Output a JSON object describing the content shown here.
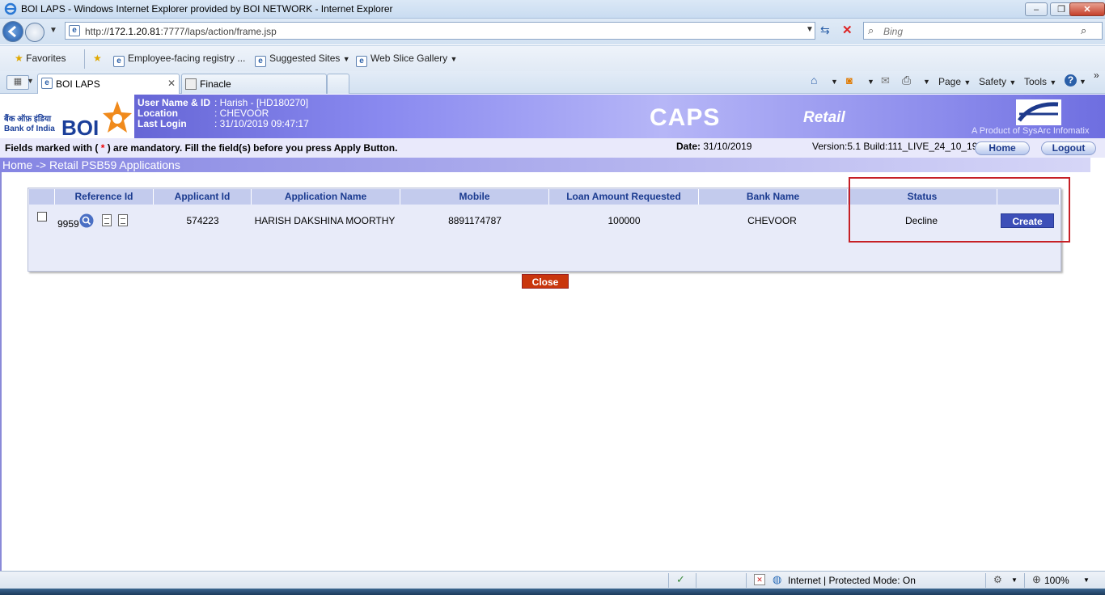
{
  "window": {
    "title": "BOI LAPS - Windows Internet Explorer provided by BOI NETWORK - Internet Explorer",
    "minimize": "–",
    "maximize": "❐",
    "close": "✕"
  },
  "address_bar": {
    "url_prefix": "http://",
    "url_host": "172.1.20.81",
    "url_path": ":7777/laps/action/frame.jsp",
    "search_placeholder": "Bing"
  },
  "favorites_bar": {
    "favorites_label": "Favorites",
    "items": [
      "Employee-facing registry ...",
      "Suggested Sites",
      "Web Slice Gallery"
    ]
  },
  "tabs": [
    {
      "label": "BOI LAPS",
      "active": true
    },
    {
      "label": "Finacle",
      "active": false
    }
  ],
  "command_bar": {
    "page": "Page",
    "safety": "Safety",
    "tools": "Tools"
  },
  "app_header": {
    "logo_hindi": "बैंक ऑफ़ इंडिया",
    "logo_en": "Bank of India",
    "logo_boi": "BOI",
    "user_label": "User Name & ID",
    "user_value": ":  Harish - [HD180270]",
    "location_label": "Location",
    "location_value": ":  CHEVOOR",
    "last_login_label": "Last Login",
    "last_login_value": ": 31/10/2019 09:47:17",
    "product": "CAPS",
    "module": "Retail",
    "vendor": "A Product of SysArc Infomatix"
  },
  "info_bar": {
    "mandatory_prefix": "Fields marked with (",
    "mandatory_star": " * ",
    "mandatory_suffix": ") are mandatory. Fill the field(s) before you press Apply Button.",
    "date_label": "Date:",
    "date_value": "31/10/2019",
    "version": "Version:5.1  Build:111_LIVE_24_10_19",
    "home_button": "Home",
    "logout_button": "Logout"
  },
  "breadcrumb": "Home -> Retail PSB59 Applications",
  "table": {
    "columns": [
      "Reference Id",
      "Applicant Id",
      "Application Name",
      "Mobile",
      "Loan Amount Requested",
      "Bank Name",
      "Status"
    ],
    "rows": [
      {
        "reference_id": "9959",
        "applicant_id": "574223",
        "application_name": "HARISH DAKSHINA MOORTHY",
        "mobile": "8891174787",
        "loan_amount": "100000",
        "bank_name": "CHEVOOR",
        "status": "Decline",
        "action": "Create"
      }
    ]
  },
  "close_button": "Close",
  "status_bar": {
    "zone": "Internet | Protected Mode: On",
    "zoom": "100%"
  },
  "colors": {
    "header_gradient": "#5353c8",
    "table_header": "#c3cbed",
    "create_button": "#3d4fb8",
    "close_button": "#c9360d",
    "highlight_box": "#c62026"
  }
}
